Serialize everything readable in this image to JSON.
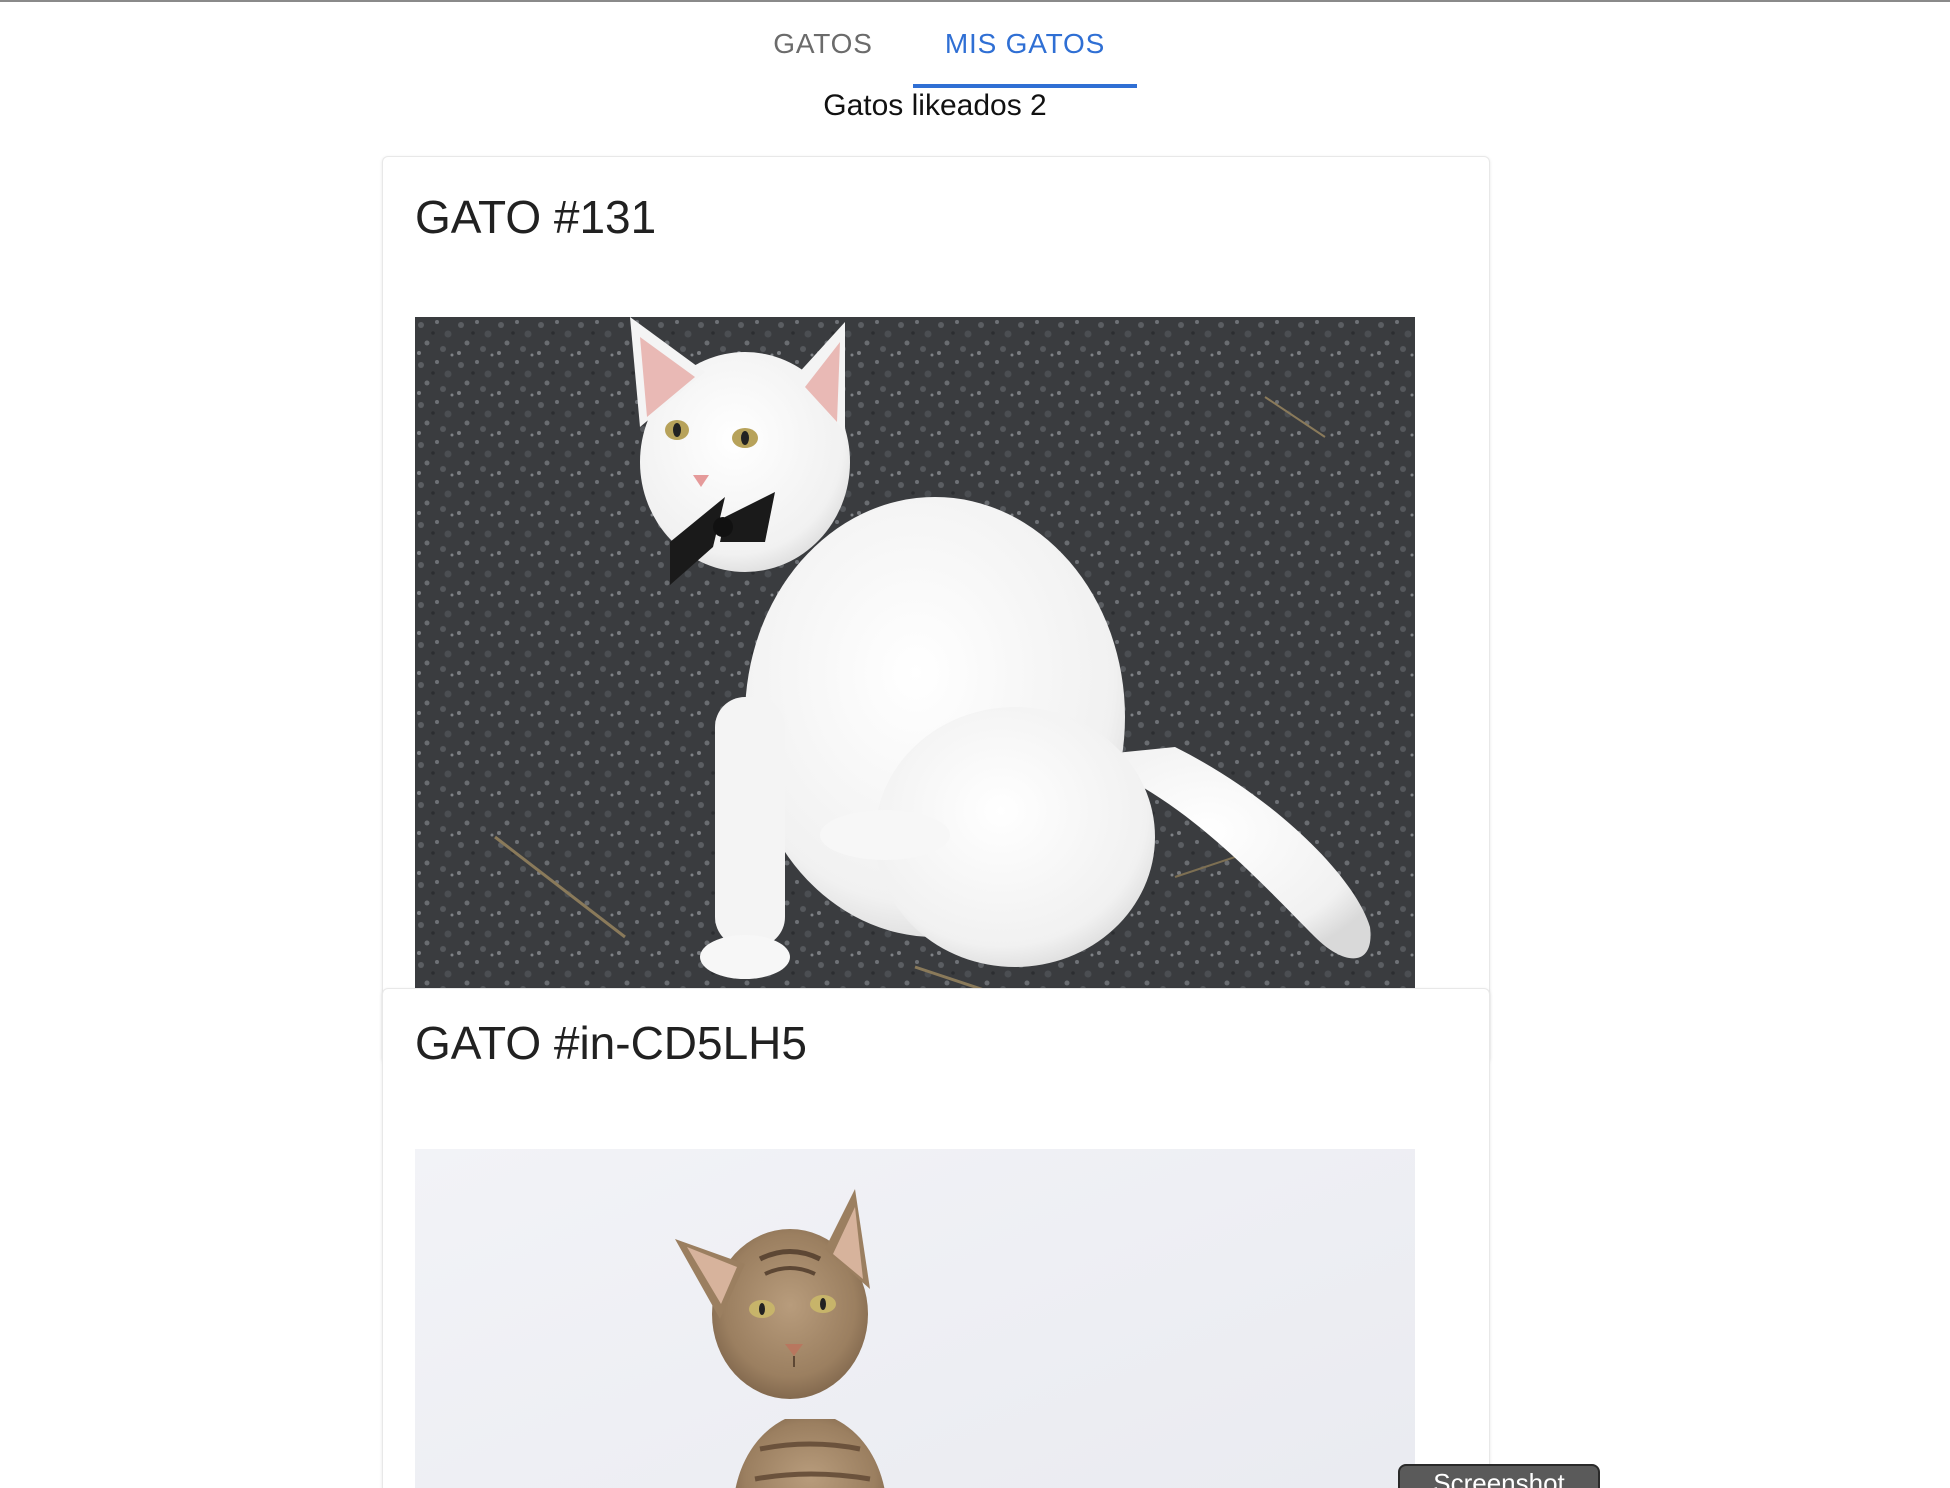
{
  "tabs": [
    {
      "label": "GATOS",
      "active": false
    },
    {
      "label": "MIS GATOS",
      "active": true
    }
  ],
  "accent_color": "#2f6fd4",
  "liked": {
    "label": "Gatos likeados 2"
  },
  "cards": [
    {
      "title": "GATO #131",
      "image": "white-cat-bowtie-photo"
    },
    {
      "title": "GATO #in-CD5LH5",
      "image": "tabby-kitten-photo"
    }
  ],
  "screenshot_button": {
    "label": "Screenshot"
  }
}
